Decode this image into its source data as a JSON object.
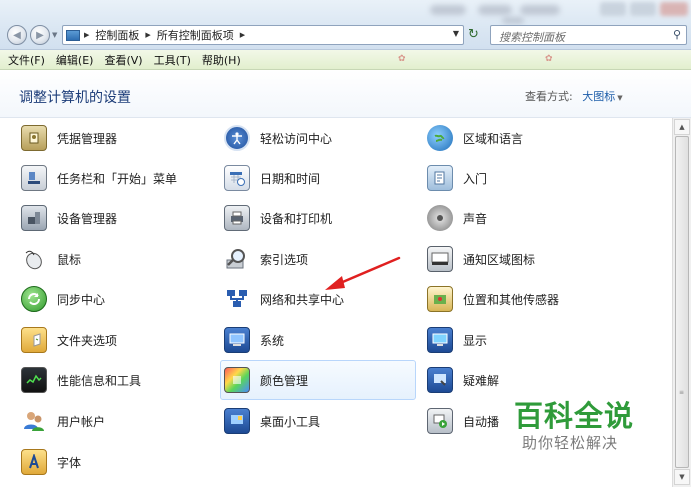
{
  "address_bar": {
    "crumbs": [
      "控制面板",
      "所有控制面板项"
    ],
    "search_placeholder": "搜索控制面板"
  },
  "menu": {
    "items": [
      "文件(F)",
      "编辑(E)",
      "查看(V)",
      "工具(T)",
      "帮助(H)"
    ]
  },
  "header": {
    "title": "调整计算机的设置",
    "view_by_label": "查看方式:",
    "view_by_value": "大图标"
  },
  "items": [
    {
      "label": "凭据管理器",
      "icon": "credential-manager-icon"
    },
    {
      "label": "轻松访问中心",
      "icon": "ease-of-access-icon"
    },
    {
      "label": "区域和语言",
      "icon": "region-language-icon"
    },
    {
      "label": "任务栏和「开始」菜单",
      "icon": "taskbar-icon"
    },
    {
      "label": "日期和时间",
      "icon": "date-time-icon"
    },
    {
      "label": "入门",
      "icon": "getting-started-icon"
    },
    {
      "label": "设备管理器",
      "icon": "device-manager-icon"
    },
    {
      "label": "设备和打印机",
      "icon": "printer-icon"
    },
    {
      "label": "声音",
      "icon": "sound-icon"
    },
    {
      "label": "鼠标",
      "icon": "mouse-icon"
    },
    {
      "label": "索引选项",
      "icon": "indexing-icon"
    },
    {
      "label": "通知区域图标",
      "icon": "notification-area-icon"
    },
    {
      "label": "同步中心",
      "icon": "sync-center-icon"
    },
    {
      "label": "网络和共享中心",
      "icon": "network-icon"
    },
    {
      "label": "位置和其他传感器",
      "icon": "location-sensor-icon"
    },
    {
      "label": "文件夹选项",
      "icon": "folder-options-icon"
    },
    {
      "label": "系统",
      "icon": "system-icon"
    },
    {
      "label": "显示",
      "icon": "display-icon"
    },
    {
      "label": "性能信息和工具",
      "icon": "performance-icon"
    },
    {
      "label": "颜色管理",
      "icon": "color-management-icon"
    },
    {
      "label": "疑难解",
      "icon": "troubleshooting-icon"
    },
    {
      "label": "用户帐户",
      "icon": "user-accounts-icon"
    },
    {
      "label": "桌面小工具",
      "icon": "gadgets-icon"
    },
    {
      "label": "自动播",
      "icon": "autoplay-icon"
    },
    {
      "label": "字体",
      "icon": "fonts-icon"
    }
  ],
  "watermark": {
    "brand": "百科全说",
    "slogan": "助你轻松解决"
  }
}
